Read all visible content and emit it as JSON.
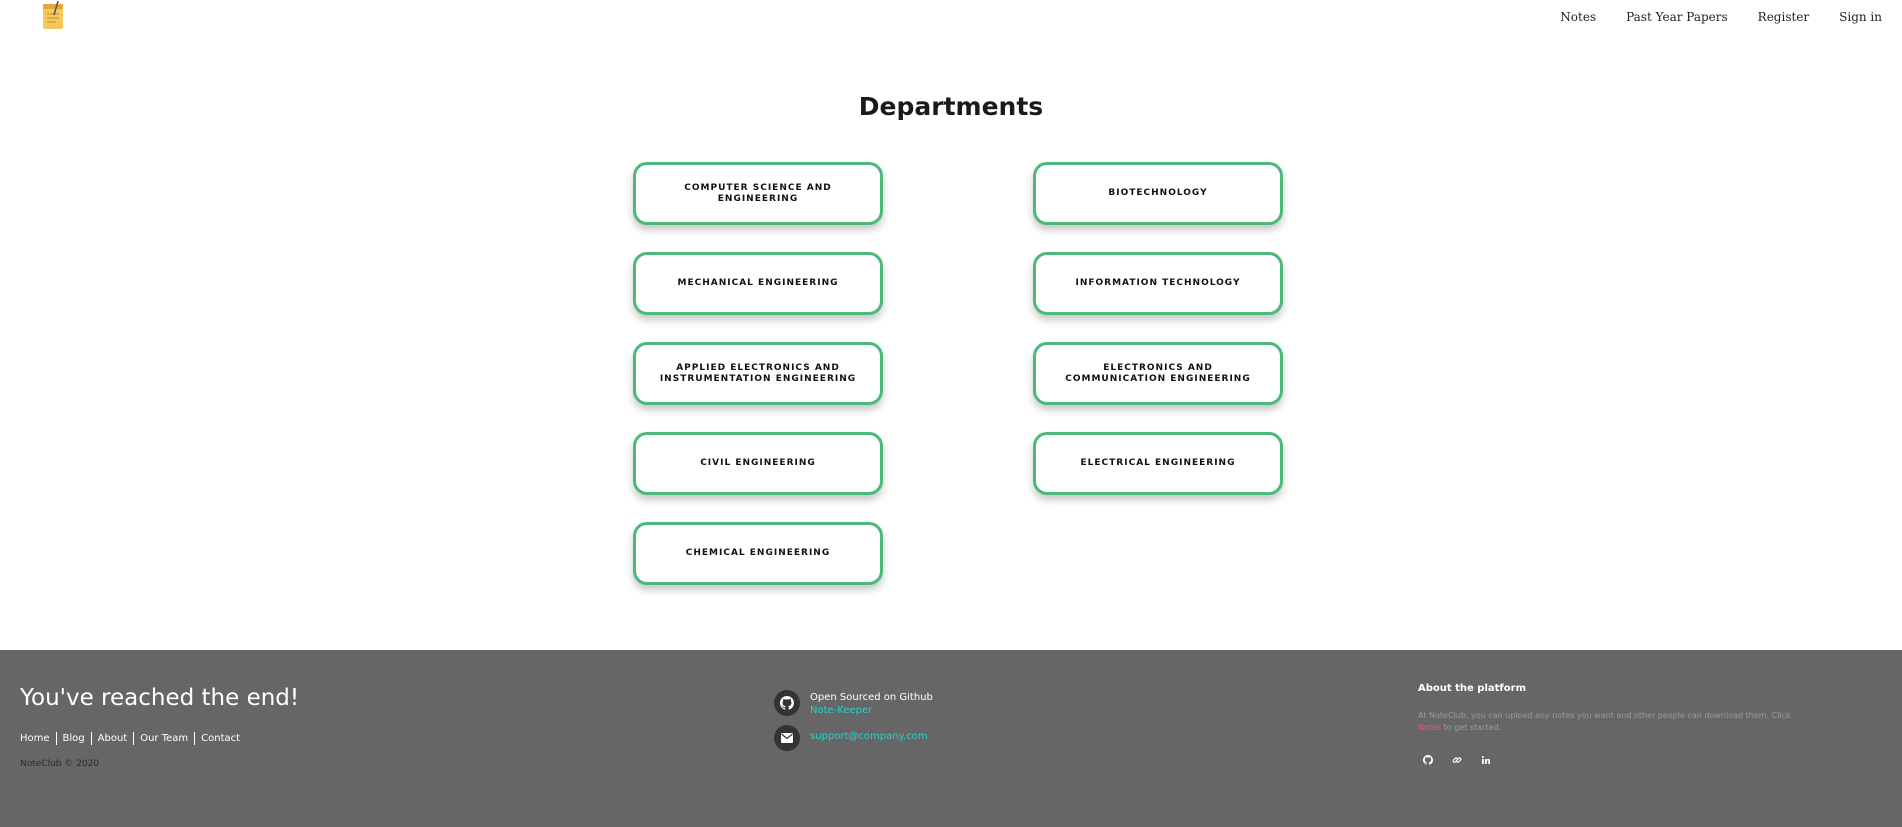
{
  "nav": {
    "logo_icon": "notepad-logo-icon",
    "links": [
      "Notes",
      "Past Year Papers",
      "Register",
      "Sign in"
    ]
  },
  "page_title": "Departments",
  "departments": [
    "COMPUTER SCIENCE AND ENGINEERING",
    "BIOTECHNOLOGY",
    "MECHANICAL ENGINEERING",
    "INFORMATION TECHNOLOGY",
    "APPLIED ELECTRONICS AND INSTRUMENTATION ENGINEERING",
    "ELECTRONICS AND COMMUNICATION ENGINEERING",
    "CIVIL ENGINEERING",
    "ELECTRICAL ENGINEERING",
    "CHEMICAL ENGINEERING"
  ],
  "footer": {
    "headline": "You've reached the end!",
    "links": [
      "Home",
      "Blog",
      "About",
      "Our Team",
      "Contact"
    ],
    "copyright": "NoteClub © 2020",
    "github_label": "Open Sourced on Github",
    "github_link": "Note-Keeper",
    "email": "support@company.com",
    "about_title": "About the platform",
    "about_text_before": "At NoteClub, you can upload any notes you want and other people can download them. Click ",
    "about_text_link": "Notes",
    "about_text_after": " to get started.",
    "social_icons": [
      "github-icon",
      "link-icon",
      "linkedin-icon"
    ]
  },
  "colors": {
    "card_border": "#4cb97a",
    "footer_bg": "#666666",
    "accent_link": "#2bd0c6",
    "highlight": "#ff4d6d"
  }
}
